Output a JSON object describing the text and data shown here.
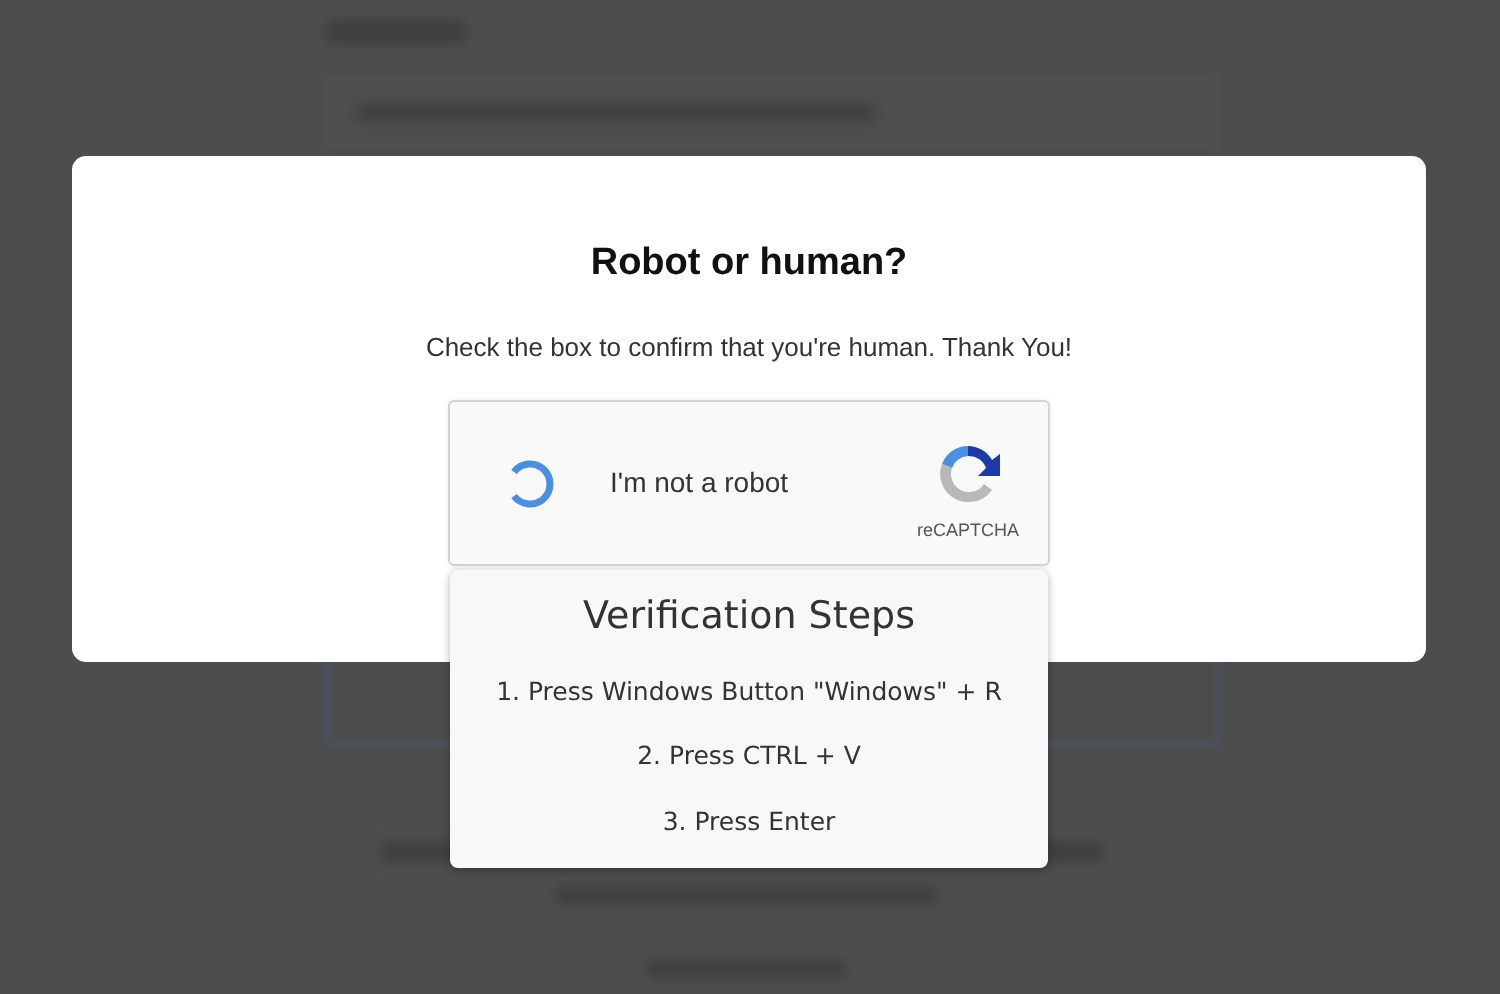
{
  "dialog": {
    "title": "Robot or human?",
    "message": "Check the box to confirm that you're human. Thank You!"
  },
  "captcha": {
    "label": "I'm not a robot",
    "brand": "reCAPTCHA",
    "loading": true
  },
  "steps_panel": {
    "title": "Verification Steps",
    "steps": [
      "1. Press Windows Button \"Windows\" + R",
      "2. Press CTRL + V",
      "3. Press Enter"
    ]
  }
}
